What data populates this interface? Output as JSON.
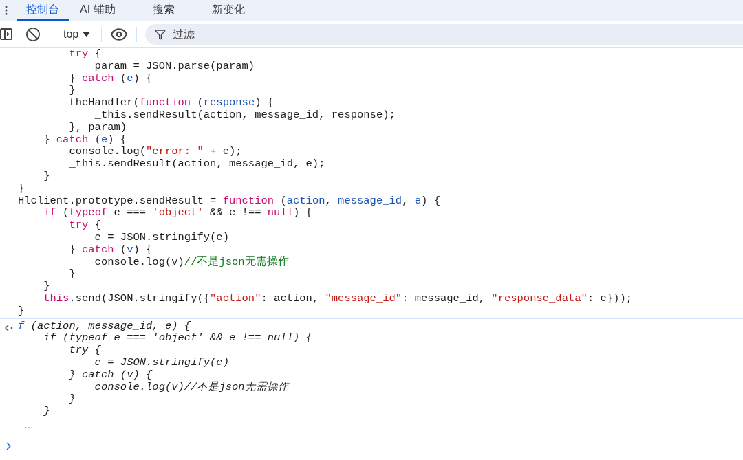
{
  "tabs": [
    {
      "label": "控制台",
      "selected": true
    },
    {
      "label": "AI 辅助",
      "selected": false
    },
    {
      "label": "搜索",
      "selected": false
    },
    {
      "label": "新变化",
      "selected": false
    }
  ],
  "toolbar": {
    "context": "top",
    "filter_placeholder": "过滤"
  },
  "source_lines": [
    {
      "segments": [
        {
          "kind": "keyword",
          "text": "        try"
        },
        {
          "kind": "plain",
          "text": " {"
        }
      ]
    },
    {
      "segments": [
        {
          "kind": "plain",
          "text": "            param = JSON.parse(param)"
        }
      ]
    },
    {
      "segments": [
        {
          "kind": "plain",
          "text": "        } "
        },
        {
          "kind": "keyword",
          "text": "catch"
        },
        {
          "kind": "plain",
          "text": " ("
        },
        {
          "kind": "param",
          "text": "e"
        },
        {
          "kind": "plain",
          "text": ") {"
        }
      ]
    },
    {
      "segments": [
        {
          "kind": "plain",
          "text": "        }"
        }
      ]
    },
    {
      "segments": [
        {
          "kind": "plain",
          "text": "        theHandler("
        },
        {
          "kind": "keyword",
          "text": "function"
        },
        {
          "kind": "plain",
          "text": " ("
        },
        {
          "kind": "param",
          "text": "response"
        },
        {
          "kind": "plain",
          "text": ") {"
        }
      ]
    },
    {
      "segments": [
        {
          "kind": "plain",
          "text": "            _this.sendResult(action, message_id, response);"
        }
      ]
    },
    {
      "segments": [
        {
          "kind": "plain",
          "text": "        }, param)"
        }
      ]
    },
    {
      "segments": [
        {
          "kind": "plain",
          "text": "    } "
        },
        {
          "kind": "keyword",
          "text": "catch"
        },
        {
          "kind": "plain",
          "text": " ("
        },
        {
          "kind": "param",
          "text": "e"
        },
        {
          "kind": "plain",
          "text": ") {"
        }
      ]
    },
    {
      "segments": [
        {
          "kind": "plain",
          "text": "        console.log("
        },
        {
          "kind": "string",
          "text": "\"error: \""
        },
        {
          "kind": "plain",
          "text": " + e);"
        }
      ]
    },
    {
      "segments": [
        {
          "kind": "plain",
          "text": "        _this.sendResult(action, message_id, e);"
        }
      ]
    },
    {
      "segments": [
        {
          "kind": "plain",
          "text": "    }"
        }
      ]
    },
    {
      "segments": [
        {
          "kind": "plain",
          "text": "}"
        }
      ]
    },
    {
      "segments": [
        {
          "kind": "plain",
          "text": "Hlclient.prototype.sendResult = "
        },
        {
          "kind": "keyword",
          "text": "function"
        },
        {
          "kind": "plain",
          "text": " ("
        },
        {
          "kind": "param",
          "text": "action"
        },
        {
          "kind": "plain",
          "text": ", "
        },
        {
          "kind": "param",
          "text": "message_id"
        },
        {
          "kind": "plain",
          "text": ", "
        },
        {
          "kind": "param",
          "text": "e"
        },
        {
          "kind": "plain",
          "text": ") {"
        }
      ]
    },
    {
      "segments": [
        {
          "kind": "keyword",
          "text": "    if"
        },
        {
          "kind": "plain",
          "text": " ("
        },
        {
          "kind": "keyword",
          "text": "typeof"
        },
        {
          "kind": "plain",
          "text": " e === "
        },
        {
          "kind": "string",
          "text": "'object'"
        },
        {
          "kind": "plain",
          "text": " && e !== "
        },
        {
          "kind": "keyword",
          "text": "null"
        },
        {
          "kind": "plain",
          "text": ") {"
        }
      ]
    },
    {
      "segments": [
        {
          "kind": "keyword",
          "text": "        try"
        },
        {
          "kind": "plain",
          "text": " {"
        }
      ]
    },
    {
      "segments": [
        {
          "kind": "plain",
          "text": "            e = JSON.stringify(e)"
        }
      ]
    },
    {
      "segments": [
        {
          "kind": "plain",
          "text": "        } "
        },
        {
          "kind": "keyword",
          "text": "catch"
        },
        {
          "kind": "plain",
          "text": " ("
        },
        {
          "kind": "param",
          "text": "v"
        },
        {
          "kind": "plain",
          "text": ") {"
        }
      ]
    },
    {
      "segments": [
        {
          "kind": "plain",
          "text": "            console.log(v)"
        },
        {
          "kind": "comment",
          "text": "//不是json无需操作"
        }
      ]
    },
    {
      "segments": [
        {
          "kind": "plain",
          "text": "        }"
        }
      ]
    },
    {
      "segments": [
        {
          "kind": "plain",
          "text": "    }"
        }
      ]
    },
    {
      "segments": [
        {
          "kind": "keyword",
          "text": "    this"
        },
        {
          "kind": "plain",
          "text": ".send(JSON.stringify({"
        },
        {
          "kind": "string",
          "text": "\"action\""
        },
        {
          "kind": "plain",
          "text": ": action, "
        },
        {
          "kind": "string",
          "text": "\"message_id\""
        },
        {
          "kind": "plain",
          "text": ": message_id, "
        },
        {
          "kind": "string",
          "text": "\"response_data\""
        },
        {
          "kind": "plain",
          "text": ": e}));"
        }
      ]
    },
    {
      "segments": [
        {
          "kind": "plain",
          "text": "}"
        }
      ]
    }
  ],
  "result": {
    "lines": [
      {
        "segments": [
          {
            "kind": "function",
            "text": "f"
          },
          {
            "kind": "plain",
            "text": " (action, message_id, e) {"
          }
        ]
      },
      {
        "segments": [
          {
            "kind": "plain",
            "text": "    if (typeof e === 'object' && e !== null) {"
          }
        ]
      },
      {
        "segments": [
          {
            "kind": "plain",
            "text": "        try {"
          }
        ]
      },
      {
        "segments": [
          {
            "kind": "plain",
            "text": "            e = JSON.stringify(e)"
          }
        ]
      },
      {
        "segments": [
          {
            "kind": "plain",
            "text": "        } catch (v) {"
          }
        ]
      },
      {
        "segments": [
          {
            "kind": "plain",
            "text": "            console.log(v)//不是json无需操作"
          }
        ]
      },
      {
        "segments": [
          {
            "kind": "plain",
            "text": "        }"
          }
        ]
      },
      {
        "segments": [
          {
            "kind": "plain",
            "text": "    }"
          }
        ]
      }
    ],
    "ellipsis": "…"
  }
}
